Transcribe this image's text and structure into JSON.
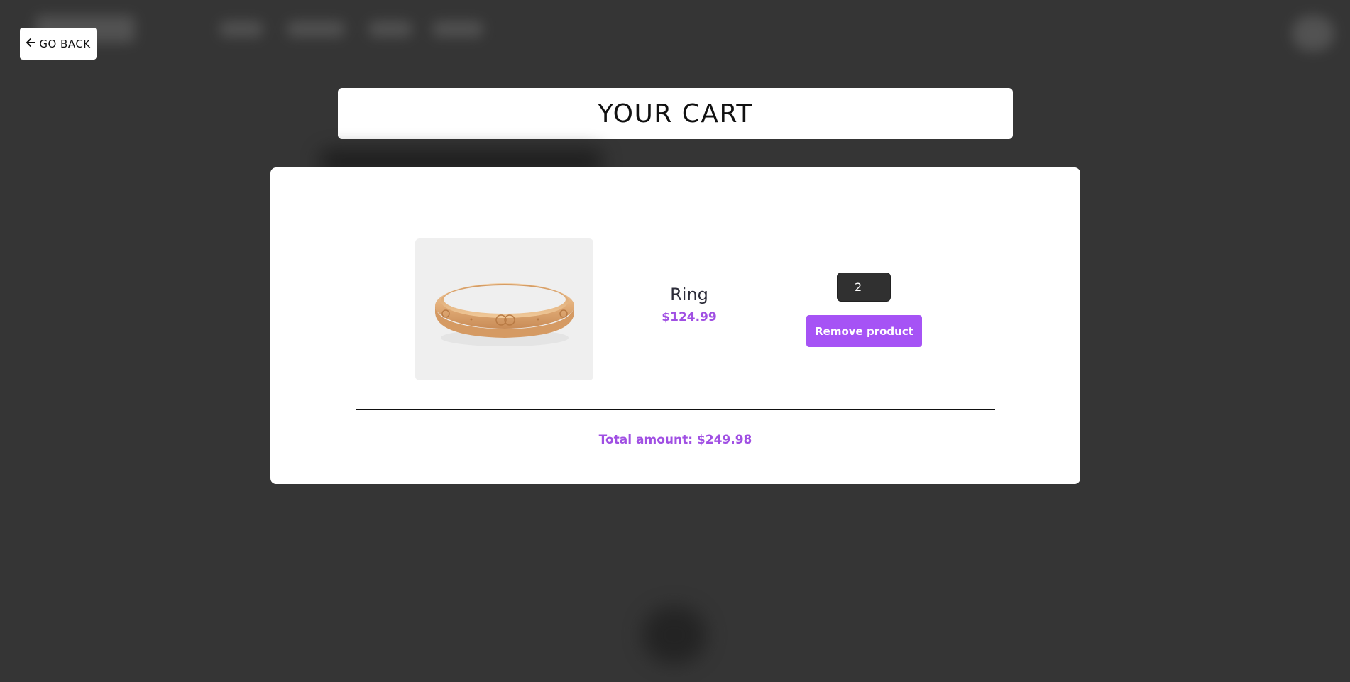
{
  "nav": {
    "back_label": "GO BACK",
    "back_icon": "arrow-left-icon"
  },
  "page": {
    "title": "YOUR CART"
  },
  "cart": {
    "items": [
      {
        "image_alt": "ring-image",
        "name": "Ring",
        "price": "$124.99",
        "quantity": "2",
        "remove_label": "Remove product"
      }
    ],
    "total_label": "Total amount: $249.98"
  },
  "colors": {
    "background": "#353535",
    "accent": "#a653f5",
    "price_text": "#a04fe3",
    "qty_input_bg": "#303030"
  }
}
